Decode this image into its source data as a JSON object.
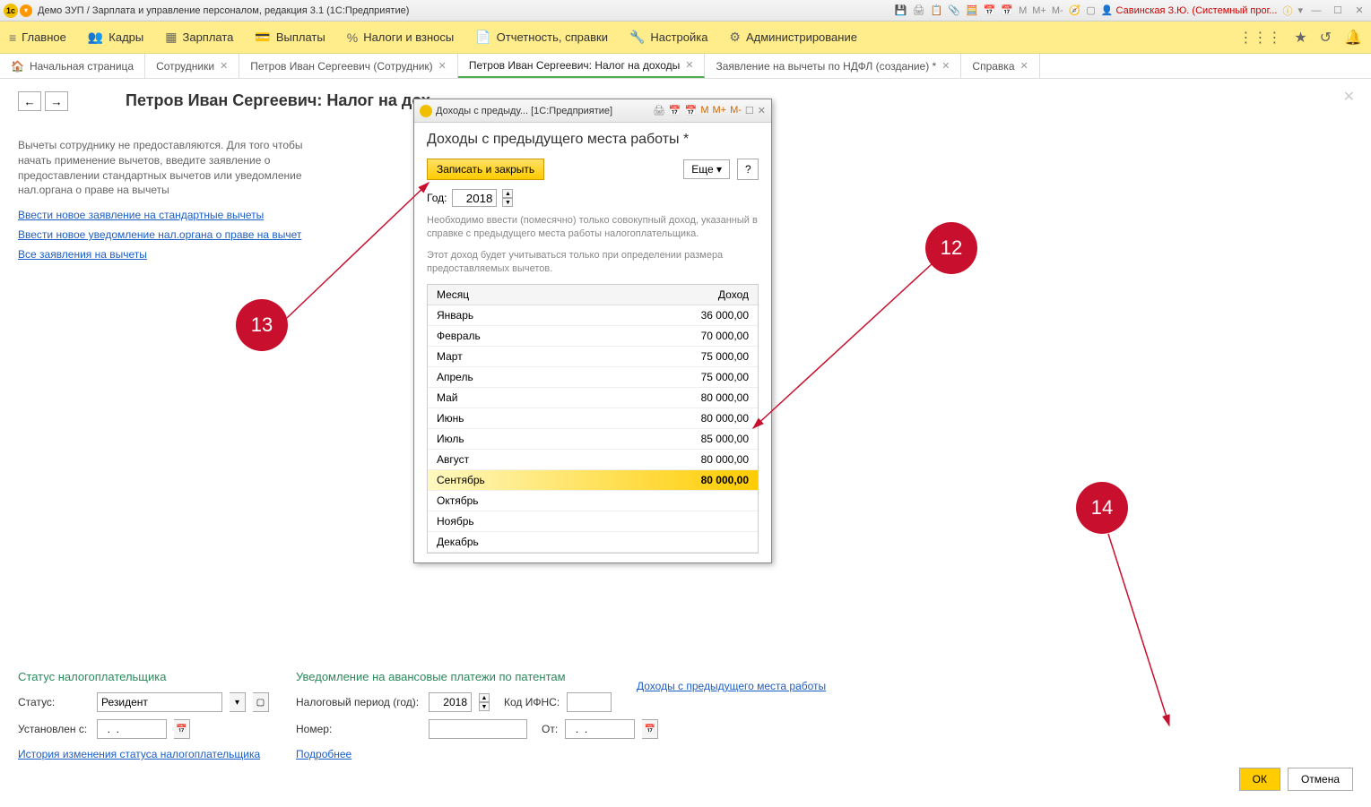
{
  "titlebar": {
    "app_icon_text": "1c",
    "title": "Демо ЗУП / Зарплата и управление персоналом, редакция 3.1  (1С:Предприятие)",
    "m_label": "M",
    "mplus_label": "M+",
    "mminus_label": "M-",
    "user": "Савинская З.Ю. (Системный прог...",
    "info_icon": "ⓘ"
  },
  "mainmenu": {
    "items": [
      {
        "icon": "≡",
        "label": "Главное"
      },
      {
        "icon": "👥",
        "label": "Кадры"
      },
      {
        "icon": "▦",
        "label": "Зарплата"
      },
      {
        "icon": "💳",
        "label": "Выплаты"
      },
      {
        "icon": "%",
        "label": "Налоги и взносы"
      },
      {
        "icon": "📄",
        "label": "Отчетность, справки"
      },
      {
        "icon": "🔧",
        "label": "Настройка"
      },
      {
        "icon": "⚙",
        "label": "Администрирование"
      }
    ]
  },
  "tabs": [
    {
      "label": "Начальная страница"
    },
    {
      "label": "Сотрудники"
    },
    {
      "label": "Петров Иван Сергеевич (Сотрудник)"
    },
    {
      "label": "Петров Иван Сергеевич: Налог на доходы"
    },
    {
      "label": "Заявление на вычеты по НДФЛ (создание) *"
    },
    {
      "label": "Справка"
    }
  ],
  "page": {
    "title": "Петров Иван Сергеевич: Налог на дох",
    "info_text": "Вычеты сотруднику не предоставляются. Для того чтобы начать применение вычетов, введите заявление о предоставлении стандартных вычетов или уведомление нал.органа о праве на вычеты",
    "link1": "Ввести новое заявление на стандартные вычеты",
    "link2": "Ввести новое уведомление нал.органа о праве на вычет",
    "link3": "Все заявления на вычеты"
  },
  "dialog": {
    "tab_title": "Доходы с предыду...  [1С:Предприятие]",
    "m_label": "M",
    "mplus_label": "M+",
    "mminus_label": "M-",
    "heading": "Доходы с предыдущего места работы *",
    "save_close": "Записать и закрыть",
    "more": "Еще ▾",
    "help": "?",
    "year_label": "Год:",
    "year_value": "2018",
    "help_text1": "Необходимо ввести (помесячно) только совокупный доход, указанный в справке с предыдущего места работы налогоплательщика.",
    "help_text2": "Этот доход будет учитываться только при определении размера предоставляемых вычетов.",
    "col_month": "Месяц",
    "col_income": "Доход",
    "rows": [
      {
        "month": "Январь",
        "income": "36 000,00"
      },
      {
        "month": "Февраль",
        "income": "70 000,00"
      },
      {
        "month": "Март",
        "income": "75 000,00"
      },
      {
        "month": "Апрель",
        "income": "75 000,00"
      },
      {
        "month": "Май",
        "income": "80 000,00"
      },
      {
        "month": "Июнь",
        "income": "80 000,00"
      },
      {
        "month": "Июль",
        "income": "85 000,00"
      },
      {
        "month": "Август",
        "income": "80 000,00"
      },
      {
        "month": "Сентябрь",
        "income": "80 000,00"
      },
      {
        "month": "Октябрь",
        "income": ""
      },
      {
        "month": "Ноябрь",
        "income": ""
      },
      {
        "month": "Декабрь",
        "income": ""
      }
    ],
    "selected_index": 8
  },
  "bottom": {
    "status_group": "Статус налогоплательщика",
    "status_label": "Статус:",
    "status_value": "Резидент",
    "set_from_label": "Установлен с:",
    "set_from_value": "  .  .    ",
    "history_link": "История изменения статуса налогоплательщика",
    "notice_group": "Уведомление на авансовые платежи по патентам",
    "tax_period_label": "Налоговый период (год):",
    "tax_period_value": "2018",
    "ifns_label": "Код ИФНС:",
    "ifns_value": "",
    "number_label": "Номер:",
    "number_value": "",
    "from_label": "От:",
    "from_value": "  .  .    ",
    "details_link": "Подробнее",
    "income_link": "Доходы с предыдущего места работы"
  },
  "buttons": {
    "ok": "ОК",
    "cancel": "Отмена"
  },
  "callouts": {
    "c12": "12",
    "c13": "13",
    "c14": "14"
  }
}
